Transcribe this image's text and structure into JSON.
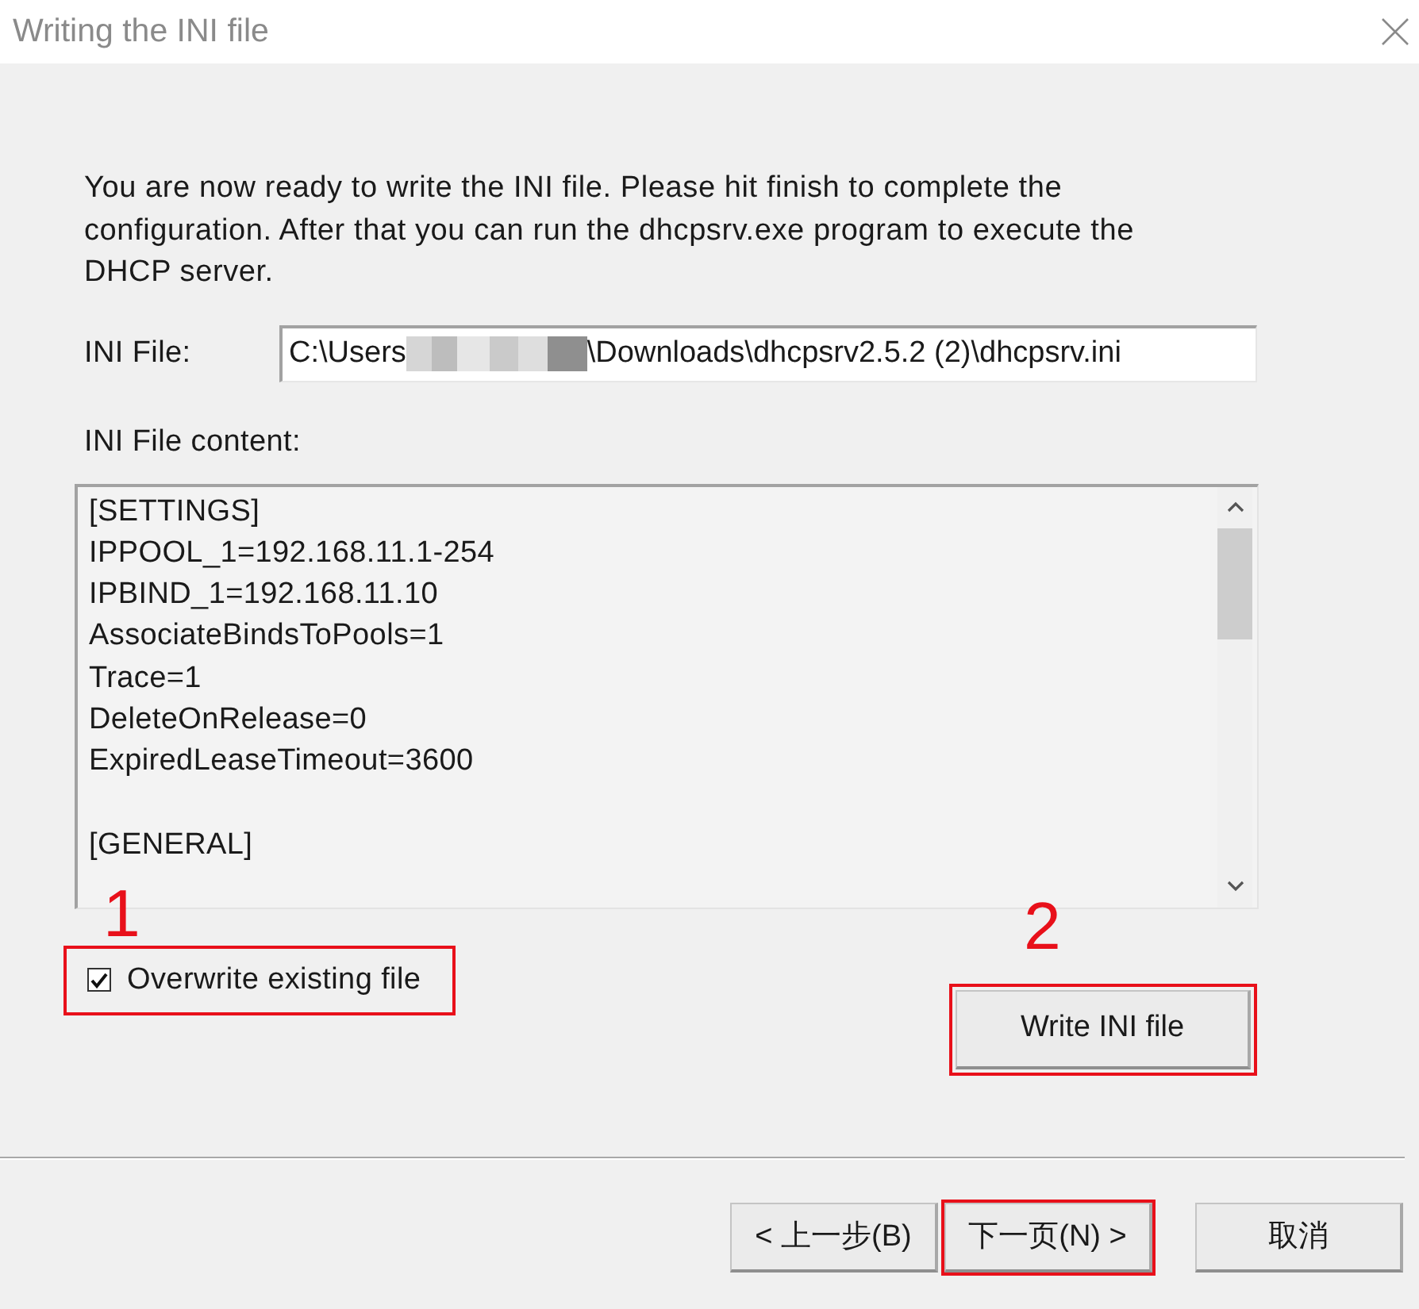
{
  "window": {
    "title": "Writing the INI file"
  },
  "intro": "You are now ready to write the INI file. Please hit finish to complete the configuration. After that you can run the dhcpsrv.exe program to execute the DHCP server.",
  "ini_file": {
    "label": "INI File:",
    "value_start": "C:\\Users",
    "redacted": true,
    "value_end": "\\Downloads\\dhcpsrv2.5.2 (2)\\dhcpsrv.ini"
  },
  "content": {
    "label": "INI File content:",
    "sections": [
      {
        "lines": [
          "[SETTINGS]",
          "IPPOOL_1=192.168.11.1-254",
          "IPBIND_1=192.168.11.10",
          "AssociateBindsToPools=1",
          "Trace=1",
          "DeleteOnRelease=0",
          "ExpiredLeaseTimeout=3600"
        ]
      },
      {
        "lines": [
          "[GENERAL]"
        ]
      }
    ]
  },
  "overwrite": {
    "label": "Overwrite existing file",
    "checked": true,
    "highlighted": true,
    "callout": "1"
  },
  "write_button": {
    "label": "Write INI file",
    "highlighted": true,
    "callout": "2"
  },
  "nav_buttons": [
    {
      "label": "< 上一步(B)",
      "highlighted": false
    },
    {
      "label": "下一页(N) >",
      "highlighted": true
    },
    {
      "label": "取消",
      "highlighted": false
    }
  ]
}
